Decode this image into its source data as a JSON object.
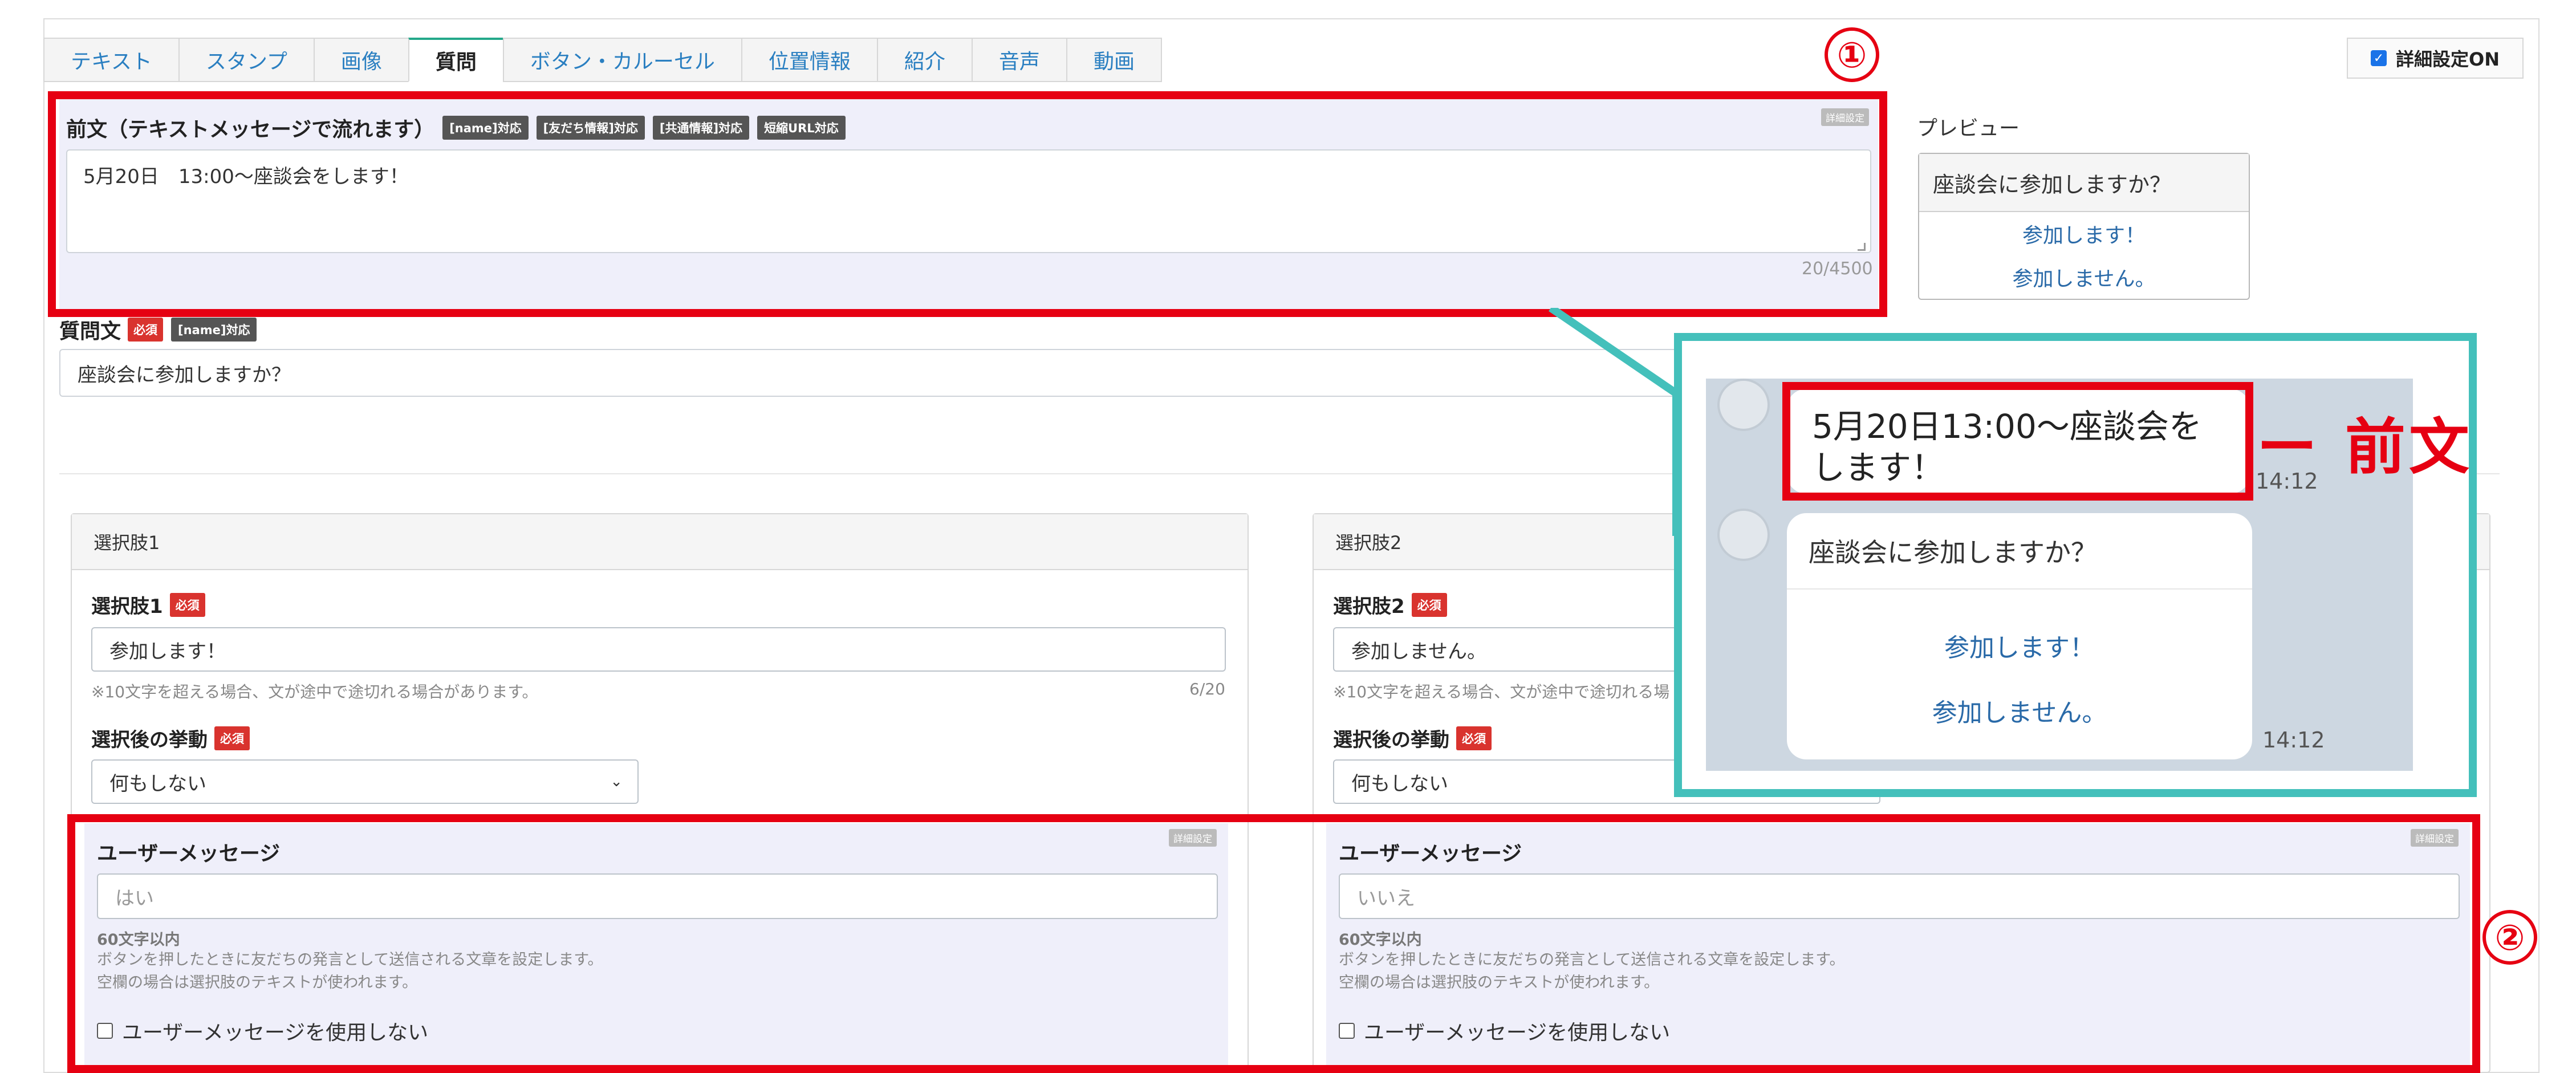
{
  "tabs": [
    {
      "label": "テキスト",
      "active": false
    },
    {
      "label": "スタンプ",
      "active": false
    },
    {
      "label": "画像",
      "active": false
    },
    {
      "label": "質問",
      "active": true
    },
    {
      "label": "ボタン・カルーセル",
      "active": false
    },
    {
      "label": "位置情報",
      "active": false
    },
    {
      "label": "紹介",
      "active": false
    },
    {
      "label": "音声",
      "active": false
    },
    {
      "label": "動画",
      "active": false
    }
  ],
  "detail_setting": {
    "label": "詳細設定ON",
    "checked": true
  },
  "pre_text": {
    "heading": "前文（テキストメッセージで流れます）",
    "tags": [
      "[name]対応",
      "[友だち情報]対応",
      "[共通情報]対応",
      "短縮URL対応"
    ],
    "detail_hide": "詳細設定",
    "value": "5月20日　13:00〜座談会をします！",
    "count": "20/4500"
  },
  "question": {
    "heading": "質問文",
    "required": "必須",
    "tag": "[name]対応",
    "value": "座談会に参加しますか？"
  },
  "preview": {
    "title": "プレビュー",
    "question": "座談会に参加しますか？",
    "buttons": [
      "参加します！",
      "参加しません。"
    ]
  },
  "choices": [
    {
      "panel_title": "選択肢1",
      "field_label": "選択肢1",
      "required": "必須",
      "value": "参加します！",
      "hint": "※10文字を超える場合、文が途中で途切れる場合があります。",
      "count": "6/20",
      "action_label": "選択後の挙動",
      "action_value": "何もしない",
      "user_message": {
        "title": "ユーザーメッセージ",
        "detail_hide": "詳細設定",
        "placeholder": "はい",
        "limit": "60文字以内",
        "desc1": "ボタンを押したときに友だちの発言として送信される文章を設定します。",
        "desc2": "空欄の場合は選択肢のテキストが使われます。",
        "checkbox": "ユーザーメッセージを使用しない"
      }
    },
    {
      "panel_title": "選択肢2",
      "field_label": "選択肢2",
      "required": "必須",
      "value": "参加しません。",
      "hint": "※10文字を超える場合、文が途中で途切れる場",
      "action_label": "選択後の挙動",
      "action_value": "何もしない",
      "user_message": {
        "title": "ユーザーメッセージ",
        "detail_hide": "詳細設定",
        "placeholder": "いいえ",
        "limit": "60文字以内",
        "desc1": "ボタンを押したときに友だちの発言として送信される文章を設定します。",
        "desc2": "空欄の場合は選択肢のテキストが使われます。",
        "checkbox": "ユーザーメッセージを使用しない"
      }
    }
  ],
  "callout": {
    "number1": "①",
    "number2": "②",
    "bubble_line1": "5月20日13:00〜座談会を",
    "bubble_line2": "します！",
    "time1": "14:12",
    "question": "座談会に参加しますか？",
    "buttons": [
      "参加します！",
      "参加しません。"
    ],
    "time2": "14:12",
    "annotation": "ー 前文"
  },
  "colors": {
    "accent_red": "#e60012",
    "callout_teal": "#44c0bb",
    "link_blue": "#2a7fc1"
  }
}
